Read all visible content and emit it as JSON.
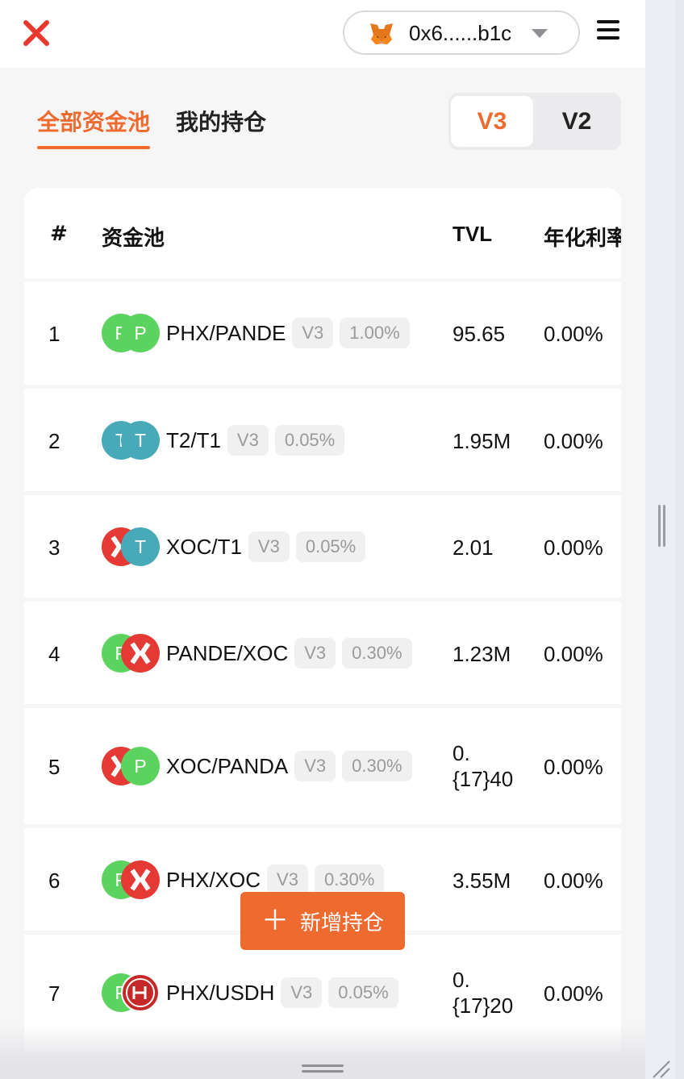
{
  "header": {
    "wallet_address": "0x6......b1c"
  },
  "tabs": {
    "all_pools": "全部资金池",
    "my_positions": "我的持仓"
  },
  "version_switch": {
    "v3": "V3",
    "v2": "V2",
    "selected": "V3"
  },
  "table": {
    "columns": [
      "#",
      "资金池",
      "TVL",
      "年化利率"
    ],
    "rows": [
      {
        "index": "1",
        "token_a": "P",
        "token_b": "P",
        "pair": "PHX/PANDE",
        "version": "V3",
        "fee": "1.00%",
        "tvl": "95.65",
        "apr": "0.00%"
      },
      {
        "index": "2",
        "token_a": "T",
        "token_b": "T",
        "pair": "T2/T1",
        "version": "V3",
        "fee": "0.05%",
        "tvl": "1.95M",
        "apr": "0.00%"
      },
      {
        "index": "3",
        "token_a": "",
        "token_b": "T",
        "pair": "XOC/T1",
        "version": "V3",
        "fee": "0.05%",
        "tvl": "2.01",
        "apr": "0.00%"
      },
      {
        "index": "4",
        "token_a": "P",
        "token_b": "",
        "pair": "PANDE/XOC",
        "version": "V3",
        "fee": "0.30%",
        "tvl": "1.23M",
        "apr": "0.00%"
      },
      {
        "index": "5",
        "token_a": "",
        "token_b": "P",
        "pair": "XOC/PANDA",
        "version": "V3",
        "fee": "0.30%",
        "tvl_line1": "0.",
        "tvl_line2": "{17}40",
        "apr": "0.00%"
      },
      {
        "index": "6",
        "token_a": "P",
        "token_b": "",
        "pair": "PHX/XOC",
        "version": "V3",
        "fee": "0.30%",
        "tvl": "3.55M",
        "apr": "0.00%"
      },
      {
        "index": "7",
        "token_a": "P",
        "token_b": "",
        "pair": "PHX/USDH",
        "version": "V3",
        "fee": "0.05%",
        "tvl_line1": "0.",
        "tvl_line2": "{17}20",
        "apr": "0.00%"
      }
    ]
  },
  "add_position_button": "新增持仓",
  "colors": {
    "accent": "#ee6a2f",
    "token_green": "#5dd35f",
    "token_teal": "#48aab9",
    "token_red": "#e53935"
  },
  "icons": [
    "app-logo-icon",
    "metamask-fox-icon",
    "chevron-down-icon",
    "hamburger-menu-icon",
    "plus-icon",
    "xoc-token-icon",
    "usdh-token-icon"
  ]
}
